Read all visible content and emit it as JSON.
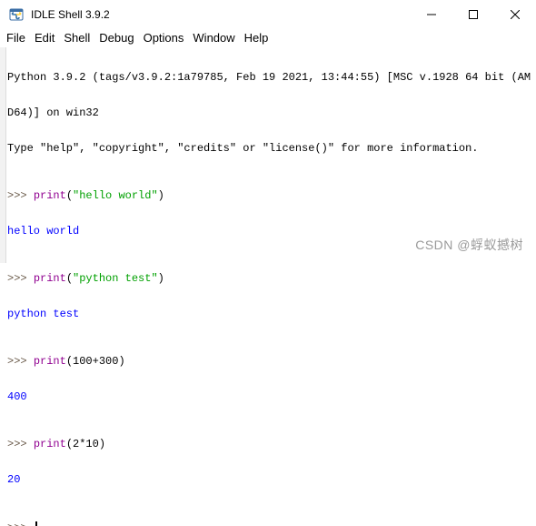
{
  "window": {
    "title": "IDLE Shell 3.9.2"
  },
  "menu": [
    "File",
    "Edit",
    "Shell",
    "Debug",
    "Options",
    "Window",
    "Help"
  ],
  "shell": {
    "banner_1": "Python 3.9.2 (tags/v3.9.2:1a79785, Feb 19 2021, 13:44:55) [MSC v.1928 64 bit (AM",
    "banner_2": "D64)] on win32",
    "banner_3": "Type \"help\", \"copyright\", \"credits\" or \"license()\" for more information.",
    "prompt": ">>> ",
    "entries": [
      {
        "fn": "print",
        "open": "(",
        "arg": "\"hello world\"",
        "close": ")",
        "output": "hello world",
        "arg_type": "str"
      },
      {
        "fn": "print",
        "open": "(",
        "arg": "\"python test\"",
        "close": ")",
        "output": "python test",
        "arg_type": "str"
      },
      {
        "fn": "print",
        "open": "(",
        "arg": "100+300",
        "close": ")",
        "output": "400",
        "arg_type": "expr"
      },
      {
        "fn": "print",
        "open": "(",
        "arg": "2*10",
        "close": ")",
        "output": "20",
        "arg_type": "expr"
      }
    ]
  },
  "watermark": "CSDN @蜉蚁撼树",
  "colors": {
    "prompt": "#6a5a4a",
    "builtin": "#900090",
    "string": "#00a000",
    "stdout": "#0000ff"
  }
}
